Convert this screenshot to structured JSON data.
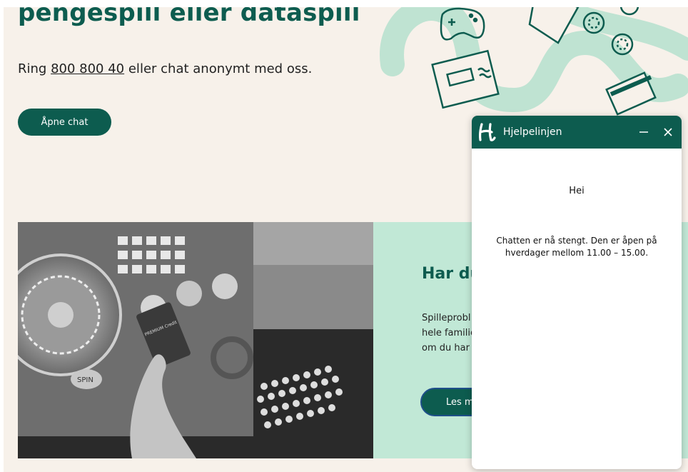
{
  "hero": {
    "title": "pengespill eller dataspill",
    "text_before": "Ring ",
    "phone": "800 800 40",
    "text_after": "  eller chat anonymt med oss.",
    "chat_button": "Åpne chat"
  },
  "info": {
    "title": "Har du",
    "lines": [
      "Spilleprobl",
      "hele familie",
      "om du har"
    ],
    "button": "Les m"
  },
  "chat": {
    "title": "Hjelpelinjen",
    "greeting": "Hei",
    "message": "Chatten er nå stengt. Den er åpen på hverdager mellom 11.00 – 15.00."
  },
  "photo_text": {
    "card": "PREMIUM Credit",
    "button_label": "SPIN"
  },
  "colors": {
    "brand_green": "#0d5c4f",
    "mint": "#c1e8d6",
    "background": "#f7f1ea"
  },
  "icons": [
    "gamepad-icon",
    "envelope-icon",
    "credit-card-icon",
    "poker-chip-icon",
    "h-logo-icon",
    "minimize-icon",
    "close-icon"
  ]
}
